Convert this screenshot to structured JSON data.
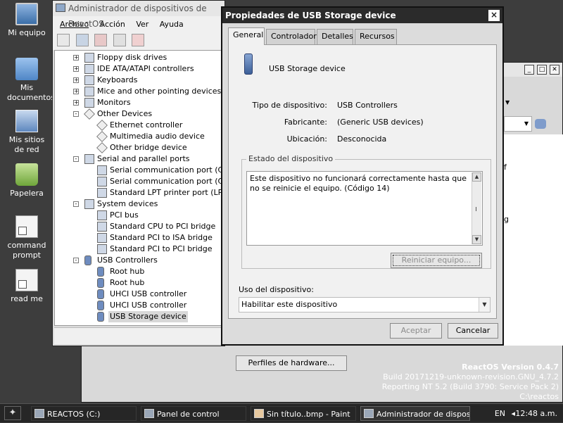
{
  "desktop": {
    "icons": [
      {
        "label": "Mi equipo",
        "icon": "computer-icon"
      },
      {
        "label": "Mis documentos",
        "icon": "documents-icon"
      },
      {
        "label": "Mis sitios de red",
        "icon": "network-icon"
      },
      {
        "label": "Papelera",
        "icon": "recycle-bin-icon"
      },
      {
        "label": "command prompt",
        "icon": "shortcut-icon"
      },
      {
        "label": "read me",
        "icon": "shortcut-icon"
      }
    ]
  },
  "device_manager": {
    "title": "Administrador de dispositivos de ReactOS",
    "menu": [
      "Archivo",
      "Acción",
      "Ver",
      "Ayuda"
    ],
    "tree": [
      {
        "label": "Floppy disk drives",
        "level": 0,
        "expander": "+"
      },
      {
        "label": "IDE ATA/ATAPI controllers",
        "level": 0,
        "expander": "+"
      },
      {
        "label": "Keyboards",
        "level": 0,
        "expander": "+"
      },
      {
        "label": "Mice and other pointing devices",
        "level": 0,
        "expander": "+"
      },
      {
        "label": "Monitors",
        "level": 0,
        "expander": "+"
      },
      {
        "label": "Other Devices",
        "level": 0,
        "expander": "-",
        "icon": "q"
      },
      {
        "label": "Ethernet controller",
        "level": 1,
        "icon": "q"
      },
      {
        "label": "Multimedia audio device",
        "level": 1,
        "icon": "q"
      },
      {
        "label": "Other bridge device",
        "level": 1,
        "icon": "q"
      },
      {
        "label": "Serial and parallel ports",
        "level": 0,
        "expander": "-"
      },
      {
        "label": "Serial communication port (COM",
        "level": 1
      },
      {
        "label": "Serial communication port (COM",
        "level": 1
      },
      {
        "label": "Standard LPT printer port (LPT1)",
        "level": 1
      },
      {
        "label": "System devices",
        "level": 0,
        "expander": "-"
      },
      {
        "label": "PCI bus",
        "level": 1
      },
      {
        "label": "Standard CPU to PCI bridge",
        "level": 1
      },
      {
        "label": "Standard PCI to ISA bridge",
        "level": 1
      },
      {
        "label": "Standard PCI to PCI bridge",
        "level": 1
      },
      {
        "label": "USB Controllers",
        "level": 0,
        "expander": "-",
        "icon": "usb"
      },
      {
        "label": "Root hub",
        "level": 1,
        "icon": "usb"
      },
      {
        "label": "Root hub",
        "level": 1,
        "icon": "usb"
      },
      {
        "label": "UHCI USB controller",
        "level": 1,
        "icon": "usb"
      },
      {
        "label": "UHCI USB controller",
        "level": 1,
        "icon": "usb"
      },
      {
        "label": "USB Storage device",
        "level": 1,
        "icon": "usb",
        "selected": true
      }
    ]
  },
  "background": {
    "hw_profiles_button": "Perfiles de hardware...",
    "fragment_text": "I ete",
    "side_fragments": [
      "f",
      "g"
    ]
  },
  "dialog": {
    "title": "Propiedades de USB Storage device",
    "close": "×",
    "tabs": [
      "General",
      "Controlador",
      "Detalles",
      "Recursos"
    ],
    "device_name": "USB Storage device",
    "properties": [
      {
        "label": "Tipo de dispositivo:",
        "value": "USB Controllers"
      },
      {
        "label": "Fabricante:",
        "value": "(Generic USB devices)"
      },
      {
        "label": "Ubicación:",
        "value": "Desconocida"
      }
    ],
    "status_group_title": "Estado del dispositivo",
    "status_text": "Este dispositivo no funcionará correctamente hasta que no se reinicie el equipo. (Código 14)",
    "restart_button": "Reiniciar equipo...",
    "usage_label": "Uso del dispositivo:",
    "usage_value": "Habilitar este dispositivo",
    "ok_button": "Aceptar",
    "cancel_button": "Cancelar"
  },
  "version_info": {
    "line1": "ReactOS Version 0.4.7",
    "line2": "Build 20171219-unknown-revision.GNU_4.7.2",
    "line3": "Reporting NT 5.2 (Build 3790: Service Pack 2)",
    "line4": "C:\\reactos"
  },
  "taskbar": {
    "tasks": [
      {
        "label": "REACTOS (C:)",
        "icon": "drive-icon"
      },
      {
        "label": "Panel de control",
        "icon": "control-panel-icon"
      },
      {
        "label": "Sin título..bmp - Paint",
        "icon": "paint-icon"
      },
      {
        "label": "Administrador de disposi...",
        "icon": "device-manager-icon",
        "active": true
      }
    ],
    "language": "EN",
    "clock": "12:48 a.m."
  }
}
